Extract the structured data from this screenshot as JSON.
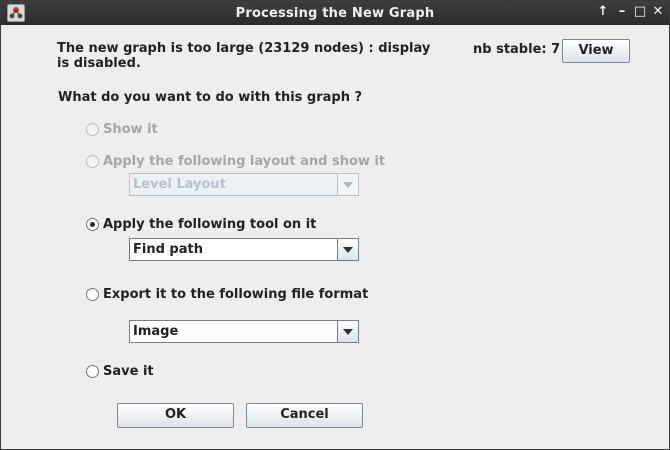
{
  "titlebar": {
    "title": "Processing the New Graph"
  },
  "message": "The new graph is too large (23129 nodes) : display is disabled.",
  "nb_stable_label": "nb stable: 7",
  "view_button": "View",
  "question": "What do you want to do with this graph ?",
  "options": [
    {
      "label": "Show it",
      "checked": false,
      "enabled": false
    },
    {
      "label": "Apply the following layout and show it",
      "checked": false,
      "enabled": false
    },
    {
      "label": "Apply the following tool on it",
      "checked": true,
      "enabled": true
    },
    {
      "label": "Export it to the following file format",
      "checked": false,
      "enabled": true
    },
    {
      "label": "Save it",
      "checked": false,
      "enabled": true
    }
  ],
  "layout_combo": {
    "value": "Level Layout",
    "enabled": false
  },
  "tool_combo": {
    "value": "Find path",
    "enabled": true
  },
  "format_combo": {
    "value": "Image",
    "enabled": true
  },
  "ok_button": "OK",
  "cancel_button": "Cancel",
  "icons": {
    "app": "app-icon",
    "up": "up-arrow-icon",
    "minimize": "minimize-icon",
    "maximize": "maximize-icon",
    "close": "close-icon"
  }
}
